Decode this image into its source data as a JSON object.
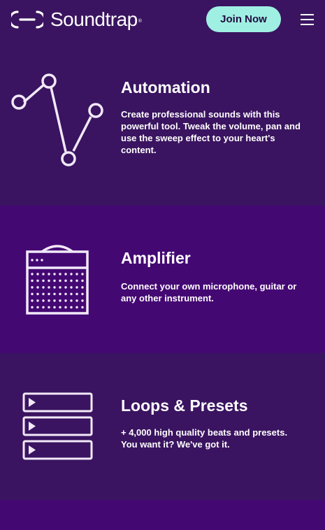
{
  "header": {
    "logo_text": "Soundtrap",
    "logo_reg": "®",
    "join_label": "Join Now",
    "menu_icon": "hamburger-menu-icon"
  },
  "features": [
    {
      "title": "Automation",
      "description": "Create professional sounds with this powerful tool. Tweak the volume, pan and use the sweep effect to your heart's content.",
      "icon": "automation-curve-icon"
    },
    {
      "title": "Amplifier",
      "description": "Connect your own microphone, guitar or any other instrument.",
      "icon": "amplifier-icon"
    },
    {
      "title": "Loops & Presets",
      "description": "+ 4,000 high quality beats and presets. You want it? We've got it.",
      "icon": "loops-presets-icon"
    }
  ],
  "colors": {
    "background_dark": "#3a1460",
    "background_alt": "#440873",
    "accent": "#9ff0e3",
    "icon_stroke": "#ffffff"
  }
}
